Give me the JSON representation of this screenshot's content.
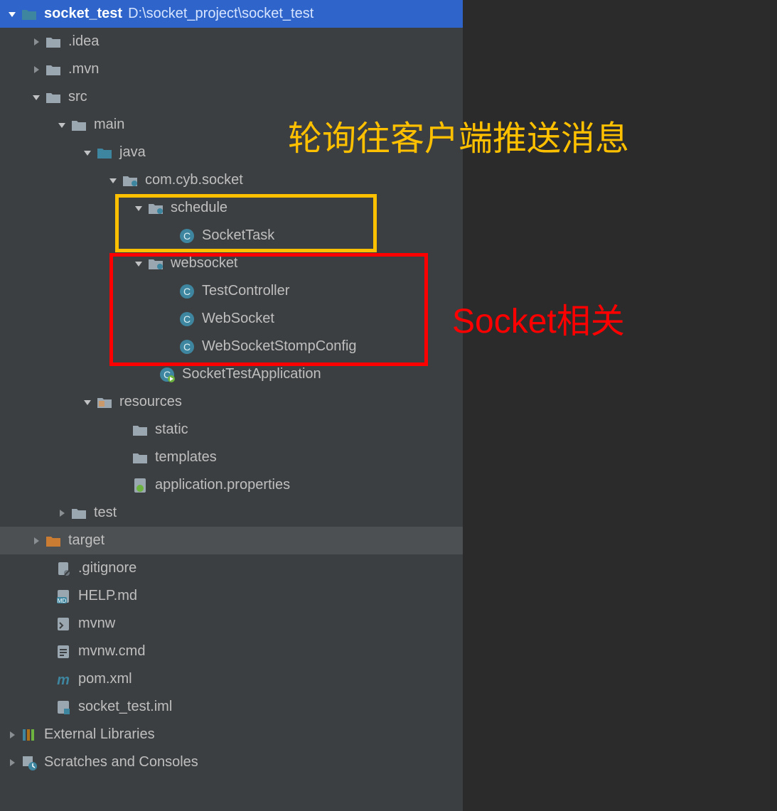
{
  "root": {
    "name": "socket_test",
    "path": "D:\\socket_project\\socket_test"
  },
  "nodes": {
    "idea": ".idea",
    "mvn": ".mvn",
    "src": "src",
    "main": "main",
    "java": "java",
    "pkg": "com.cyb.socket",
    "schedule": "schedule",
    "socketTask": "SocketTask",
    "websocket": "websocket",
    "testController": "TestController",
    "webSocket": "WebSocket",
    "webSocketStompConfig": "WebSocketStompConfig",
    "socketTestApp": "SocketTestApplication",
    "resources": "resources",
    "static": "static",
    "templates": "templates",
    "appProps": "application.properties",
    "test": "test",
    "target": "target",
    "gitignore": ".gitignore",
    "helpmd": "HELP.md",
    "mvnw": "mvnw",
    "mvnwcmd": "mvnw.cmd",
    "pomxml": "pom.xml",
    "iml": "socket_test.iml",
    "extLib": "External Libraries",
    "scratches": "Scratches and Consoles"
  },
  "annotations": {
    "orange_text": "轮询往客户端推送消息",
    "red_text": "Socket相关"
  },
  "colors": {
    "bg": "#2b2b2b",
    "panel": "#3c3f41",
    "selected": "#2f65ca",
    "highlight": "#4c5052",
    "text": "#bfbfbf",
    "orange": "#ffc000",
    "red": "#ff0000",
    "folder": "#9aa7b0",
    "folderBlue": "#3e86a0",
    "folderOrange": "#c97c32",
    "classCircle": "#3e86a0"
  }
}
